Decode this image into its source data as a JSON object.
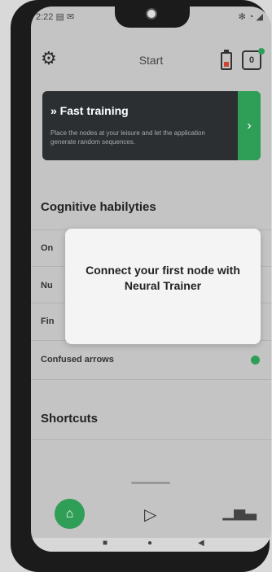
{
  "status_bar": {
    "time": "2:22",
    "icons_left": "▤ ✉",
    "icons_right": "✻ ◔ ◢"
  },
  "header": {
    "title": "Start",
    "node_count": "0"
  },
  "fast_training": {
    "title": "» Fast training",
    "description": "Place the nodes at your leisure and let the application generate random sequences."
  },
  "cognitive": {
    "title": "Cognitive habilyties",
    "items": [
      {
        "label": "On"
      },
      {
        "label": "Nu"
      },
      {
        "label": "Fin"
      },
      {
        "label": "Confused arrows"
      }
    ]
  },
  "shortcuts": {
    "title": "Shortcuts"
  },
  "modal": {
    "text": "Connect your first node with Neural Trainer"
  },
  "colors": {
    "accent": "#2f9e57",
    "card_bg": "#2b2f32"
  },
  "icons": {
    "settings": "gear-icon",
    "battery": "battery-icon",
    "home": "home-icon",
    "play": "play-icon",
    "stats": "bar-chart-icon"
  }
}
